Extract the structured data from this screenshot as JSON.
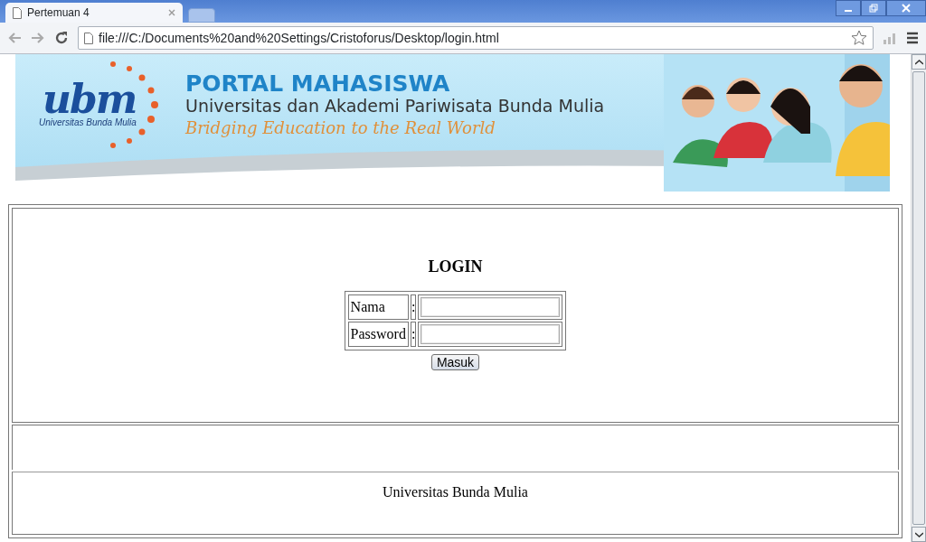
{
  "browser": {
    "tab_title": "Pertemuan 4",
    "address": "file:///C:/Documents%20and%20Settings/Cristoforus/Desktop/login.html"
  },
  "banner": {
    "logo": "ubm",
    "logo_caption": "Universitas Bunda Mulia",
    "title": "PORTAL MAHASISWA",
    "subtitle": "Universitas dan Akademi Pariwisata Bunda Mulia",
    "tagline": "Bridging Education to the Real World"
  },
  "login": {
    "heading": "LOGIN",
    "fields": [
      {
        "label": "Nama",
        "separator": ":"
      },
      {
        "label": "Password",
        "separator": ":"
      }
    ],
    "button": "Masuk"
  },
  "footer": {
    "text": "Universitas Bunda Mulia"
  }
}
